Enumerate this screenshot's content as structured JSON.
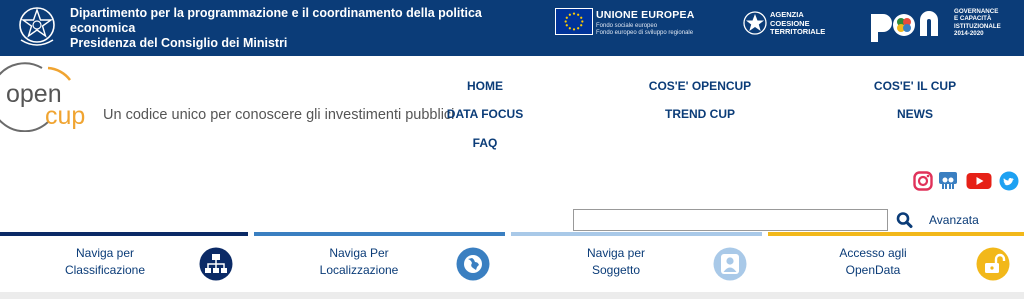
{
  "topbar": {
    "department": [
      "Dipartimento per la programmazione e il coordinamento della politica",
      "economica",
      "Presidenza del Consiglio dei Ministri"
    ],
    "eu": {
      "title": "UNIONE EUROPEA",
      "lines": [
        "Fondo sociale europeo",
        "Fondo europeo di sviluppo regionale"
      ]
    },
    "agency": [
      "AGENZIA",
      "COESIONE",
      "TERRITORIALE"
    ],
    "pon": [
      "GOVERNANCE",
      "E CAPACITÀ",
      "ISTITUZIONALE",
      "2014-2020"
    ]
  },
  "header": {
    "logo_top": "open",
    "logo_bottom": "cup",
    "tagline": "Un codice unico per conoscere gli investimenti pubblici"
  },
  "nav": {
    "home": "HOME",
    "cos_opencup": "COS'E' OPENCUP",
    "cos_cup": "COS'E' IL CUP",
    "data_focus": "DATA FOCUS",
    "trend_cup": "TREND CUP",
    "news": "NEWS",
    "faq": "FAQ"
  },
  "social": [
    "instagram-icon",
    "slideshare-icon",
    "youtube-icon",
    "twitter-icon"
  ],
  "search": {
    "value": "",
    "advanced_label": "Avanzata"
  },
  "cards": [
    {
      "line1": "Naviga per",
      "line2": "Classificazione",
      "color": "#0b2a66",
      "icon": "hierarchy-icon"
    },
    {
      "line1": "Naviga Per",
      "line2": "Localizzazione",
      "color": "#3a7fc1",
      "icon": "globe-icon"
    },
    {
      "line1": "Naviga per",
      "line2": "Soggetto",
      "color": "#a9c9e8",
      "icon": "user-icon"
    },
    {
      "line1": "Accesso agli",
      "line2": "OpenData",
      "color": "#f2b81a",
      "icon": "unlock-icon"
    }
  ],
  "colors": {
    "brand_blue": "#0b3c78",
    "logo_orange": "#f0a431",
    "text_gray": "#555555"
  }
}
